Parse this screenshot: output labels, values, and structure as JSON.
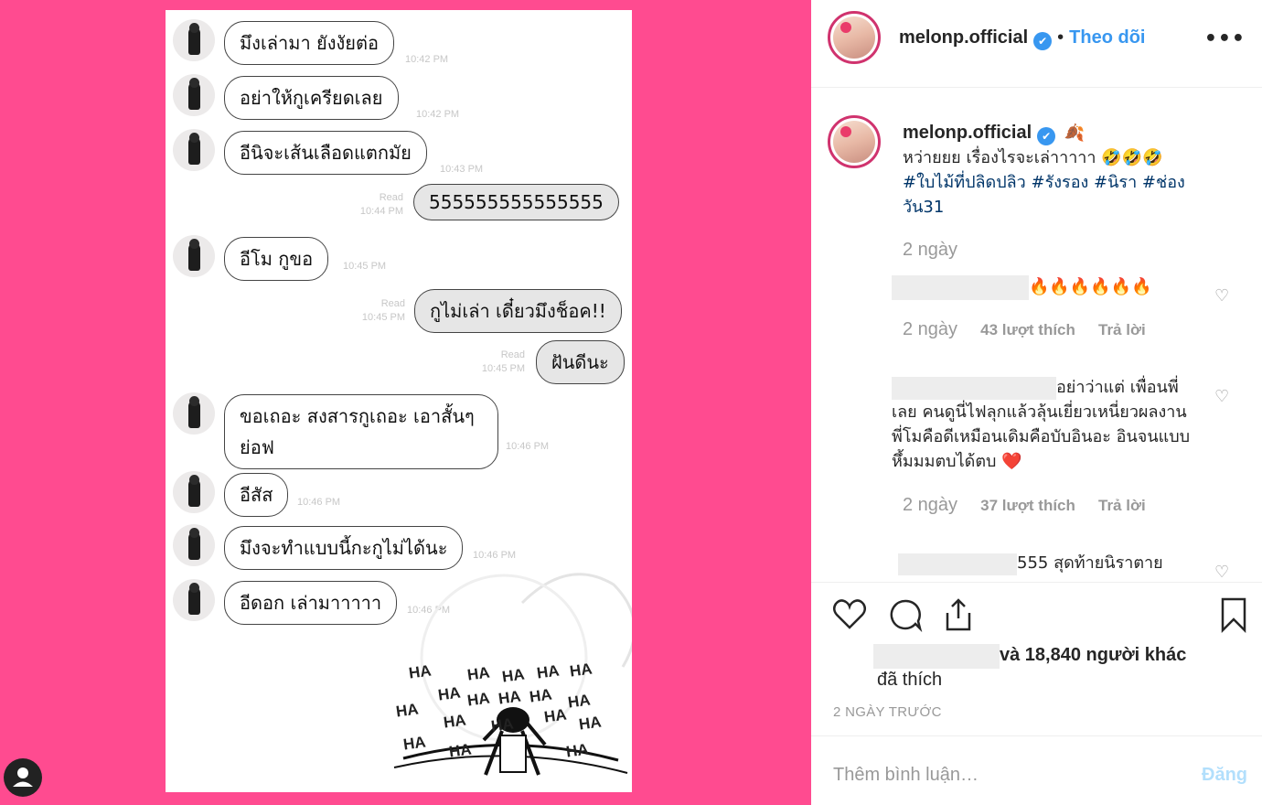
{
  "chat": {
    "rows": [
      {
        "text": "มึงเล่ามา ยังงัยต่อ",
        "time": "10:42 PM"
      },
      {
        "text": "อย่าให้กูเครียดเลย",
        "time": "10:42 PM"
      },
      {
        "text": "อีนิจะเส้นเลือดแตกมัย",
        "time": "10:43 PM"
      },
      {
        "text": "555555555555555",
        "read": "Read",
        "time": "10:44 PM"
      },
      {
        "text": "อีโม กูขอ",
        "time": "10:45 PM"
      },
      {
        "text": "กูไม่เล่า เดี๋ยวมึงช็อค!!",
        "read": "Read",
        "time": "10:45 PM"
      },
      {
        "text": "ฝันดีนะ",
        "read": "Read",
        "time": "10:45 PM"
      },
      {
        "text": "ขอเถอะ สงสารกูเถอะ เอาสั้นๆ ย่อฟ",
        "time": "10:46 PM"
      },
      {
        "text": "อีสัส",
        "time": "10:46 PM"
      },
      {
        "text": "มึงจะทำแบบนี้กะกูไม่ได้นะ",
        "time": "10:46 PM"
      },
      {
        "text": "อีดอก เล่ามาาาาา",
        "time": "10:46 PM"
      }
    ],
    "comic_text": "HA"
  },
  "header": {
    "username": "melonp.official",
    "verified_mark": "✔",
    "separator": "•",
    "follow_label": "Theo dõi",
    "more_label": "•••"
  },
  "caption": {
    "username": "melonp.official",
    "leaf_emoji": "🍂",
    "text": "หว่ายยย เรื่องไรจะเล่าาาาา",
    "laugh_emoji": "🤣🤣🤣",
    "hashtags": "#ใบไม้ที่ปลิดปลิว #รังรอง #นิรา #ช่องวัน31",
    "time": "2 ngày"
  },
  "comments": [
    {
      "text": "🔥🔥🔥🔥🔥🔥",
      "time": "2 ngày",
      "likes": "43 lượt thích",
      "reply": "Trả lời"
    },
    {
      "text": "อย่าว่าแต่ เพื่อนพี่เลย คนดูนี่ไฟลุกแล้วลุ้นเยี่ยวเหนี่ยวผลงานพี่โมคือดีเหมือนเดิมคือบับอินอะ อินจนแบบหึ้มมมตบได้ตบ",
      "heart_emoji": "❤️",
      "time": "2 ngày",
      "likes": "37 lượt thích",
      "reply": "Trả lời"
    },
    {
      "text": "555 สุดท้ายนิราตาย"
    }
  ],
  "actions": {
    "liked_by_suffix": "và 18,840 người khác",
    "liked_label": "đã thích",
    "time_ago": "2 NGÀY TRƯỚC",
    "comment_placeholder": "Thêm bình luận…",
    "post_label": "Đăng"
  }
}
